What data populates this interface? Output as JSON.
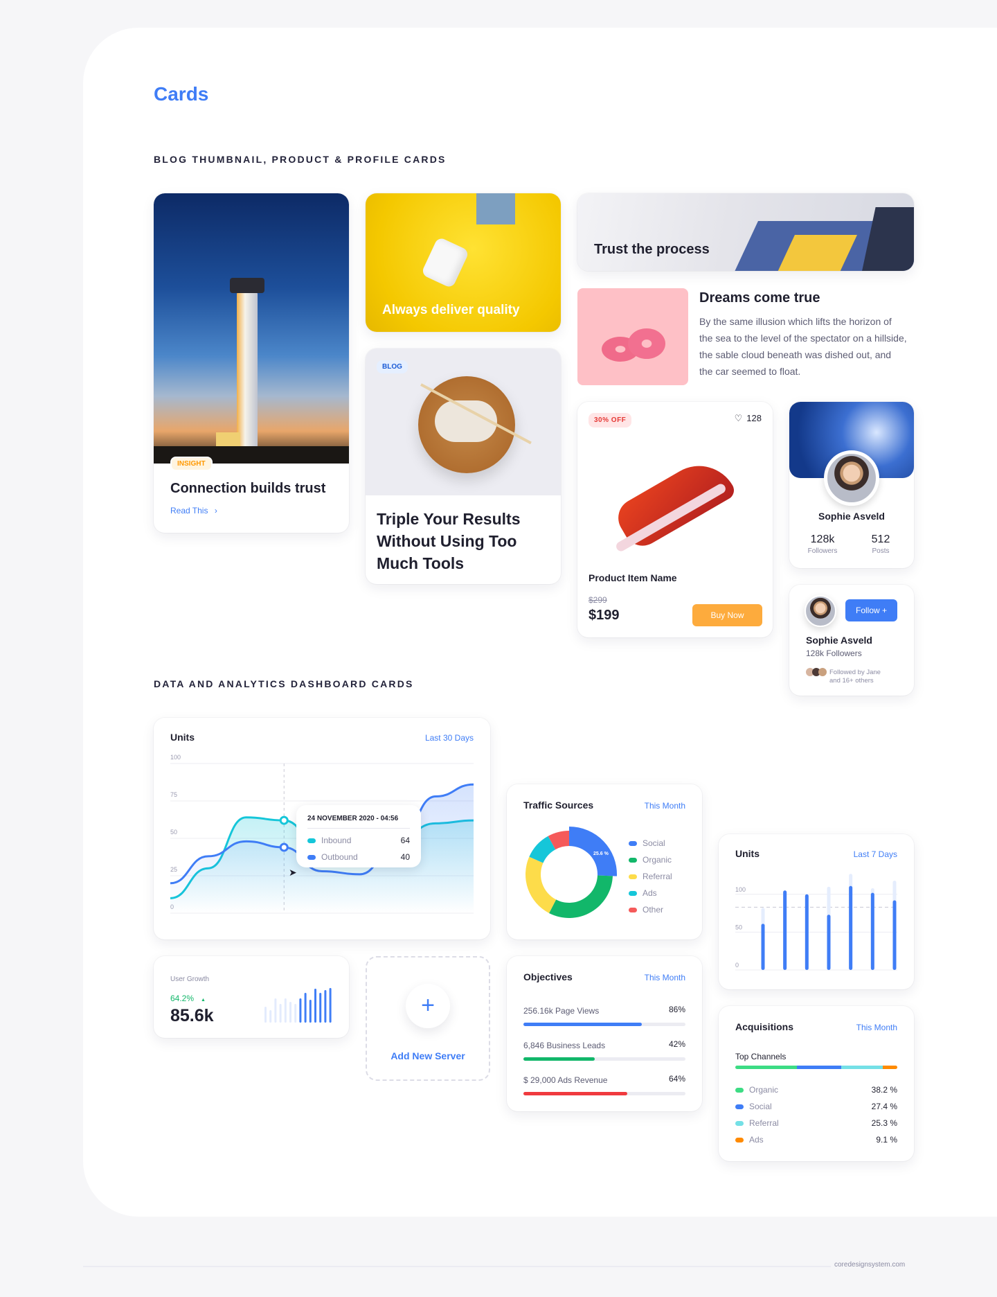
{
  "page": {
    "title": "Cards",
    "section1": "BLOG THUMBNAIL, PRODUCT & PROFILE CARDS",
    "section2": "DATA AND ANALYTICS DASHBOARD CARDS",
    "footer": "coredesignsystem.com"
  },
  "blog_insight": {
    "badge": "INSIGHT",
    "title": "Connection builds trust",
    "link": "Read This",
    "link_icon": "chevron-right-icon"
  },
  "blog_quality": {
    "title": "Always deliver quality"
  },
  "blog_triple": {
    "badge": "BLOG",
    "title": "Triple Your Results Without Using Too Much Tools"
  },
  "blog_trust": {
    "title": "Trust the process"
  },
  "blog_dreams": {
    "title": "Dreams come true",
    "body": "By the same illusion which lifts the horizon of the sea to the level of the spectator on a hillside, the sable cloud beneath was dished out, and the car seemed to float."
  },
  "product": {
    "badge": "30% OFF",
    "likes": "128",
    "like_icon": "heart-icon",
    "name": "Product Item Name",
    "old_price": "$299",
    "price": "$199",
    "buy": "Buy Now"
  },
  "profile": {
    "name": "Sophie Asveld",
    "followers": "128k",
    "followers_label": "Followers",
    "posts": "512",
    "posts_label": "Posts"
  },
  "follow_card": {
    "name": "Sophie Asveld",
    "sub": "128k Followers",
    "button": "Follow +",
    "followed_by_1": "Followed by Jane",
    "followed_by_2": "and 16+ others"
  },
  "units30": {
    "title": "Units",
    "range": "Last 30 Days",
    "tooltip": {
      "date": "24 NOVEMBER 2020 - 04:56",
      "rows": [
        {
          "label": "Inbound",
          "value": "64"
        },
        {
          "label": "Outbound",
          "value": "40"
        }
      ]
    }
  },
  "traffic": {
    "title": "Traffic Sources",
    "range": "This Month",
    "center_label": "25.6 %"
  },
  "units7": {
    "title": "Units",
    "range": "Last 7 Days"
  },
  "growth": {
    "label": "User Growth",
    "change": "64.2%",
    "change_icon": "triangle-up-icon",
    "value": "85.6k"
  },
  "add_server": {
    "label": "Add New Server",
    "icon": "plus-icon"
  },
  "objectives": {
    "title": "Objectives",
    "range": "This Month",
    "items": [
      {
        "label": "256.16k Page Views",
        "pct": "86%",
        "fill": 0.73,
        "color": "#3f7df6"
      },
      {
        "label": "6,846 Business Leads",
        "pct": "42%",
        "fill": 0.44,
        "color": "#12b76a"
      },
      {
        "label": "$ 29,000 Ads Revenue",
        "pct": "64%",
        "fill": 0.64,
        "color": "#f03a3e"
      }
    ]
  },
  "acquisitions": {
    "title": "Acquisitions",
    "range": "This Month",
    "subtitle": "Top Channels",
    "items": [
      {
        "label": "Organic",
        "pct": "38.2 %",
        "value": 38.2,
        "color": "#3ddc84"
      },
      {
        "label": "Social",
        "pct": "27.4 %",
        "value": 27.4,
        "color": "#3f7df6"
      },
      {
        "label": "Referral",
        "pct": "25.3 %",
        "value": 25.3,
        "color": "#74e0e6"
      },
      {
        "label": "Ads",
        "pct": "9.1 %",
        "value": 9.1,
        "color": "#ff8a00"
      }
    ]
  },
  "chart_data": [
    {
      "type": "line",
      "title": "Units",
      "ylim": [
        0,
        100
      ],
      "yticks": [
        "0",
        "25",
        "50",
        "75",
        "100"
      ],
      "grid": true,
      "x": [
        0,
        1,
        2,
        3,
        4,
        5,
        6,
        7,
        8
      ],
      "series": [
        {
          "name": "Inbound",
          "color": "#15c6d9",
          "values": [
            10,
            30,
            64,
            62,
            42,
            35,
            50,
            60,
            62
          ]
        },
        {
          "name": "Outbound",
          "color": "#3f7df6",
          "values": [
            20,
            38,
            48,
            44,
            28,
            26,
            48,
            78,
            86
          ]
        }
      ],
      "highlight_index": 3
    },
    {
      "type": "pie",
      "title": "Traffic Sources",
      "legend": "right",
      "slices": [
        {
          "label": "Social",
          "value": 25.6,
          "color": "#3f7df6"
        },
        {
          "label": "Organic",
          "value": 32,
          "color": "#12b76a"
        },
        {
          "label": "Referral",
          "value": 24,
          "color": "#fddc4a"
        },
        {
          "label": "Ads",
          "value": 10.4,
          "color": "#15c6d9"
        },
        {
          "label": "Other",
          "value": 8,
          "color": "#f55a5a"
        }
      ]
    },
    {
      "type": "bar",
      "title": "Units",
      "ylim": [
        0,
        130
      ],
      "yticks": [
        "0",
        "50",
        "100"
      ],
      "reference_line": 83,
      "series": [
        {
          "name": "actual",
          "color": "#3f7df6",
          "values": [
            61,
            105,
            100,
            73,
            111,
            102,
            92
          ]
        },
        {
          "name": "target",
          "color": "#e5edfd",
          "values": [
            82,
            105,
            100,
            110,
            127,
            108,
            118
          ]
        }
      ]
    },
    {
      "type": "bar",
      "title": "User Growth",
      "series": [
        {
          "name": "previous",
          "color": "#e3ebfd",
          "values": [
            23,
            18,
            35,
            27,
            35,
            30,
            27
          ]
        },
        {
          "name": "current",
          "color": "#3f7df6",
          "values": [
            35,
            43,
            33,
            49,
            43,
            47,
            50
          ]
        }
      ]
    }
  ]
}
